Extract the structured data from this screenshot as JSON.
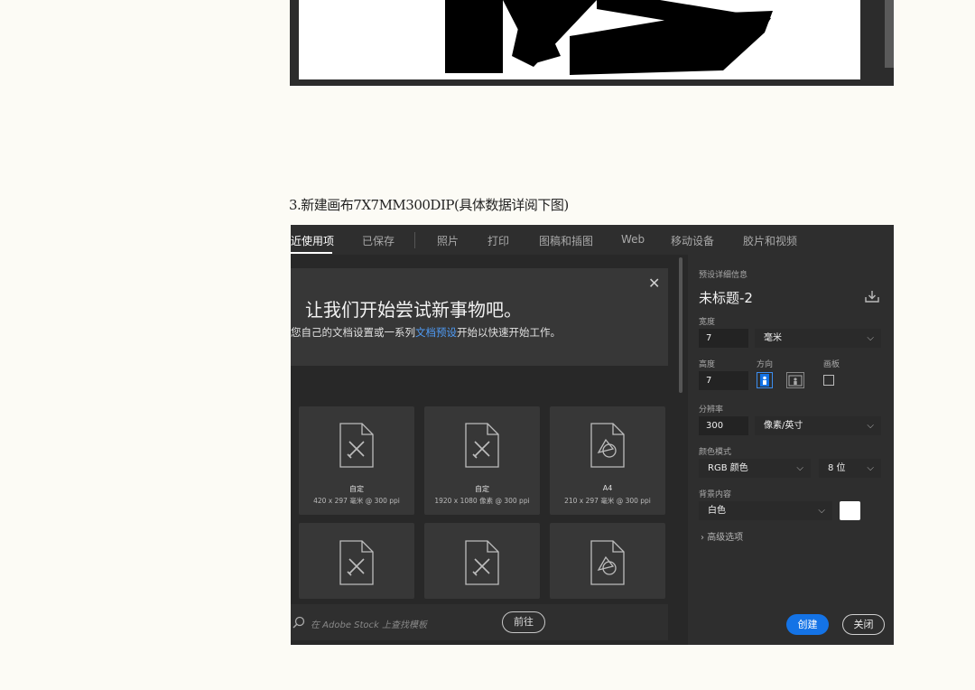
{
  "caption": "3.新建画布7X7MM300DIP(具体数据详阅下图)",
  "tabs": [
    "近使用项",
    "已保存",
    "照片",
    "打印",
    "图稿和插图",
    "Web",
    "移动设备",
    "胶片和视频"
  ],
  "welcome": {
    "title": "让我们开始尝试新事物吧。",
    "subtitle_before": "您自己的文档设置或一系列",
    "subtitle_link": "文档预设",
    "subtitle_after": "开始以快速开始工作。"
  },
  "presets": [
    {
      "name": "自定",
      "detail": "420 x 297 毫米 @ 300 ppi",
      "icon": "custom-document-icon"
    },
    {
      "name": "自定",
      "detail": "1920 x 1080 像素 @ 300 ppi",
      "icon": "custom-document-icon"
    },
    {
      "name": "A4",
      "detail": "210 x 297 毫米 @ 300 ppi",
      "icon": "print-document-icon"
    },
    {
      "name": "",
      "detail": "",
      "icon": "custom-document-icon"
    },
    {
      "name": "",
      "detail": "",
      "icon": "custom-document-icon"
    },
    {
      "name": "",
      "detail": "",
      "icon": "print-document-icon"
    }
  ],
  "stock": {
    "placeholder": "在 Adobe Stock 上查找模板",
    "go_label": "前往"
  },
  "details": {
    "section_label": "预设详细信息",
    "title": "未标题-2",
    "width_label": "宽度",
    "width_value": "7",
    "unit": "毫米",
    "height_label": "高度",
    "height_value": "7",
    "orientation_label": "方向",
    "artboard_label": "画板",
    "resolution_label": "分辨率",
    "resolution_value": "300",
    "resolution_unit": "像素/英寸",
    "color_mode_label": "颜色模式",
    "color_mode": "RGB 颜色",
    "bit_depth": "8 位",
    "bg_label": "背景内容",
    "bg_value": "白色",
    "bg_color": "#ffffff",
    "advanced_label": "高级选项",
    "create_label": "创建",
    "close_label": "关闭"
  },
  "colors": {
    "accent": "#1473e6",
    "link": "#4f9bf5",
    "dialog_bg": "#282828"
  }
}
